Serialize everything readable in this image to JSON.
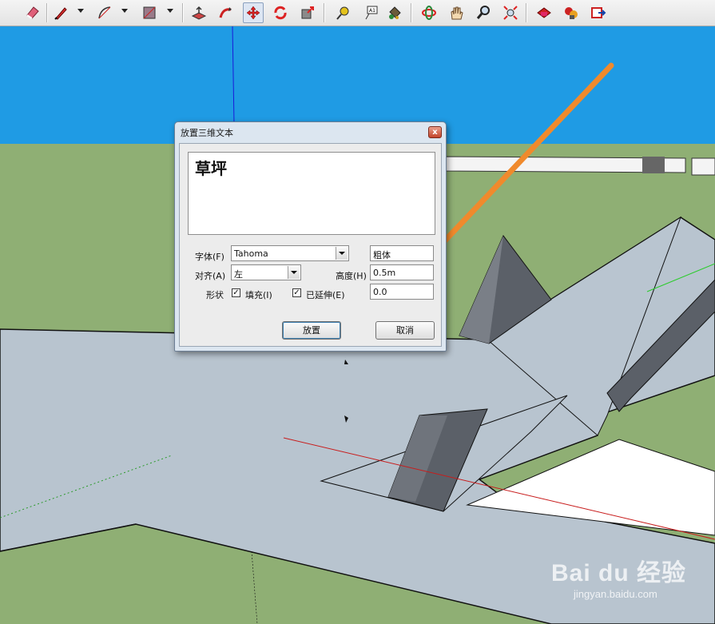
{
  "toolbar": {
    "tools": [
      {
        "icon": "eraser-icon"
      },
      {
        "icon": "pencil-icon"
      },
      {
        "icon": "arc-icon"
      },
      {
        "icon": "rectangle-icon"
      },
      {
        "icon": "push-pull-icon"
      },
      {
        "icon": "follow-me-icon"
      },
      {
        "icon": "move-icon"
      },
      {
        "icon": "rotate-icon"
      },
      {
        "icon": "scale-icon"
      },
      {
        "icon": "tape-measure-icon"
      },
      {
        "icon": "text-icon"
      },
      {
        "icon": "paint-bucket-icon"
      },
      {
        "icon": "orbit-icon"
      },
      {
        "icon": "pan-icon"
      },
      {
        "icon": "zoom-icon"
      },
      {
        "icon": "zoom-extents-icon"
      },
      {
        "icon": "warehouse-icon"
      },
      {
        "icon": "components-icon"
      },
      {
        "icon": "share-model-icon"
      }
    ]
  },
  "dialog": {
    "title": "放置三维文本",
    "text_content": "草坪",
    "font_label": "字体(F)",
    "font_value": "Tahoma",
    "style_value": "粗体",
    "align_label": "对齐(A)",
    "align_value": "左",
    "height_label": "高度(H)",
    "height_value": "0.5m",
    "shape_label": "形状",
    "fill_label": "填充(I)",
    "fill_checked": true,
    "extrude_label": "已延伸(E)",
    "extrude_checked": true,
    "extrude_value": "0.0",
    "place_button": "放置",
    "cancel_button": "取消",
    "close_glyph": "x"
  },
  "watermark": {
    "brand": "Bai du 经验",
    "url": "jingyan.baidu.com"
  },
  "colors": {
    "sky": "#1f9be4",
    "ground": "#8faf74",
    "surface": "#b8c4cf",
    "arrow": "#f08a2c"
  }
}
